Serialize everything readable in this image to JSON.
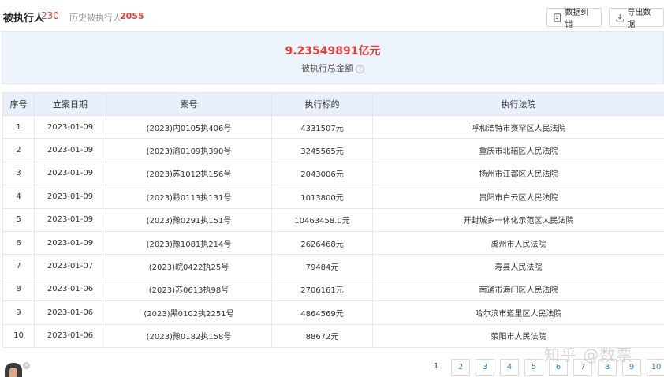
{
  "header": {
    "title": "被执行人",
    "count": "230",
    "history_label": "历史被执行人",
    "history_count": "2055",
    "chevron": "›",
    "buttons": {
      "fix": "数据纠错",
      "export": "导出数据"
    }
  },
  "summary": {
    "amount": "9.23549891亿元",
    "label": "被执行总金额",
    "help": "?"
  },
  "table": {
    "columns": [
      "序号",
      "立案日期",
      "案号",
      "执行标的",
      "执行法院"
    ],
    "rows": [
      [
        "1",
        "2023-01-09",
        "(2023)内0105执406号",
        "4331507元",
        "呼和浩特市赛罕区人民法院"
      ],
      [
        "2",
        "2023-01-09",
        "(2023)渝0109执390号",
        "3245565元",
        "重庆市北碚区人民法院"
      ],
      [
        "3",
        "2023-01-09",
        "(2023)苏1012执156号",
        "2043006元",
        "扬州市江都区人民法院"
      ],
      [
        "4",
        "2023-01-09",
        "(2023)黔0113执131号",
        "1013800元",
        "贵阳市白云区人民法院"
      ],
      [
        "5",
        "2023-01-09",
        "(2023)豫0291执151号",
        "10463458.0元",
        "开封城乡一体化示范区人民法院"
      ],
      [
        "6",
        "2023-01-09",
        "(2023)豫1081执214号",
        "2626468元",
        "禹州市人民法院"
      ],
      [
        "7",
        "2023-01-07",
        "(2023)皖0422执25号",
        "79484元",
        "寿县人民法院"
      ],
      [
        "8",
        "2023-01-06",
        "(2023)苏0613执98号",
        "2706161元",
        "南通市海门区人民法院"
      ],
      [
        "9",
        "2023-01-06",
        "(2023)黑0102执2251号",
        "4864569元",
        "哈尔滨市道里区人民法院"
      ],
      [
        "10",
        "2023-01-06",
        "(2023)豫0182执158号",
        "88672元",
        "荥阳市人民法院"
      ]
    ]
  },
  "pagination": {
    "pages": [
      "1",
      "2",
      "3",
      "4",
      "5",
      "6",
      "7",
      "8",
      "9",
      "10"
    ],
    "current": "1"
  },
  "avatar_close": "×",
  "watermark": "知乎 @数票",
  "colors": {
    "accent_red": "#e0403e",
    "link_blue": "#2d7fd0",
    "header_bg": "#e8f1fb",
    "summary_bg": "#edf4fc"
  }
}
